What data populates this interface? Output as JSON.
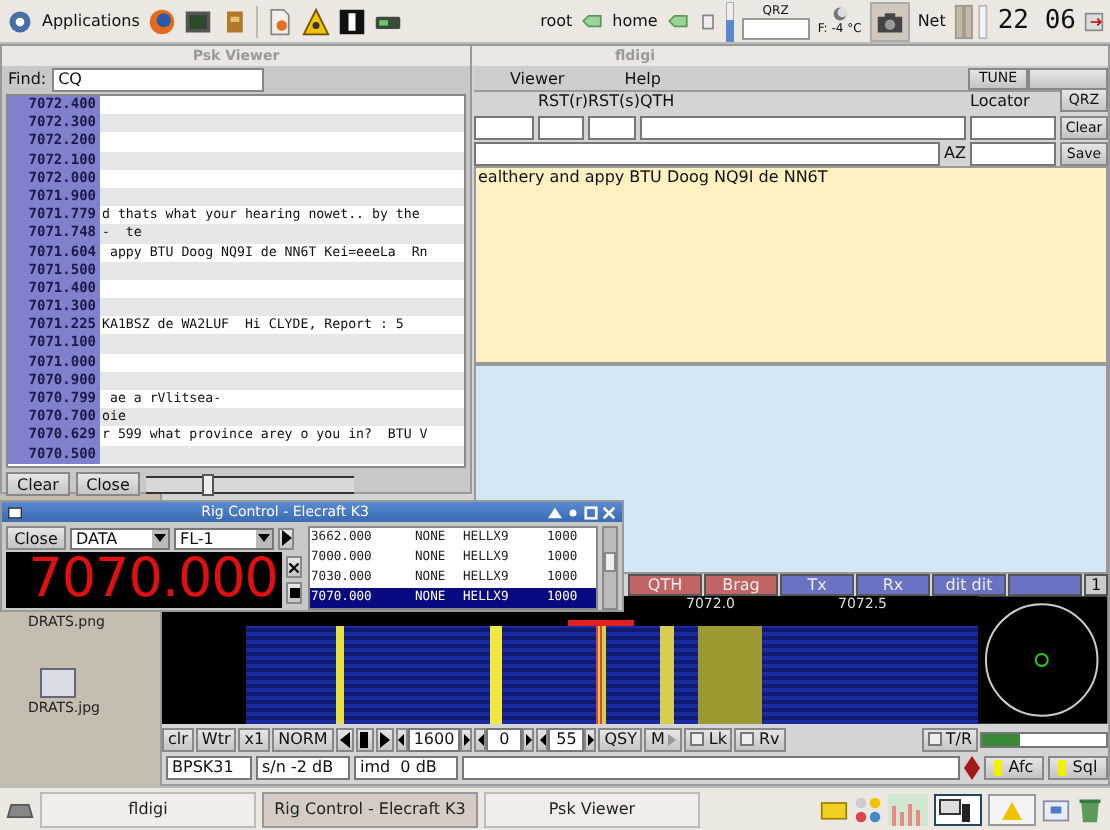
{
  "top_panel": {
    "menu": "Applications",
    "places": [
      "root",
      "home"
    ],
    "qrz_label": "QRZ",
    "temperature": "F: -4 °C",
    "network": "Net",
    "clock": "22 06"
  },
  "desktop_icons": [
    {
      "label": "DRATS.png"
    },
    {
      "label": "DRATS.jpg"
    }
  ],
  "fldigi": {
    "title": "fldigi",
    "menu": [
      "Viewer",
      "Help"
    ],
    "tune": "TUNE",
    "log_labels": [
      "RST(r)",
      "RST(s)",
      "QTH",
      "Locator"
    ],
    "az": "AZ",
    "log_buttons": [
      "QRZ",
      "Clear",
      "Save"
    ],
    "rx_text": "ealthery and appy BTU Doog NQ9I de NN6T",
    "macros": [
      {
        "label": "QTH",
        "color": "#c06464"
      },
      {
        "label": "Brag",
        "color": "#c06464"
      },
      {
        "label": "Tx",
        "color": "#6a72c4"
      },
      {
        "label": "Rx",
        "color": "#6a72c4"
      },
      {
        "label": "dit dit",
        "color": "#6a72c4"
      },
      {
        "color": "#6a72c4"
      }
    ],
    "macro_page": "1",
    "scale": [
      "7072.0",
      "7072.5"
    ],
    "controls": [
      {
        "kind": "button",
        "label": "clr"
      },
      {
        "kind": "button",
        "label": "Wtr"
      },
      {
        "kind": "button",
        "label": "x1"
      },
      {
        "kind": "button",
        "label": "NORM"
      },
      {
        "kind": "rewind"
      },
      {
        "kind": "pause"
      },
      {
        "kind": "play"
      },
      {
        "kind": "spin",
        "value": "1600"
      },
      {
        "kind": "spin",
        "value": "0"
      },
      {
        "kind": "spin",
        "value": "55"
      },
      {
        "kind": "button",
        "label": "QSY"
      },
      {
        "kind": "menu",
        "label": "M"
      },
      {
        "kind": "check",
        "label": "Lk",
        "checked": false
      },
      {
        "kind": "check",
        "label": "Rv",
        "checked": false
      }
    ],
    "tr": {
      "label": "T/R",
      "checked": false
    },
    "squelch": {
      "level": 0.3
    },
    "status": {
      "mode": "BPSK31",
      "snr": "s/n -2 dB",
      "imd": "imd  0 dB"
    },
    "toggles": [
      {
        "label": "Afc",
        "on": true
      },
      {
        "label": "Sql",
        "on": true
      }
    ]
  },
  "psk_viewer": {
    "title": "Psk Viewer",
    "find_label": "Find:",
    "find": "CQ",
    "rows": [
      {
        "freq": "7072.400"
      },
      {
        "freq": "7072.300"
      },
      {
        "freq": "7072.200"
      },
      {
        "freq": "7072.100"
      },
      {
        "freq": "7072.000"
      },
      {
        "freq": "7071.900"
      },
      {
        "freq": "7071.779",
        "text": "d thats what your hearing nowet.. by the"
      },
      {
        "freq": "7071.748",
        "text": "-  te"
      },
      {
        "freq": "7071.604",
        "text": " appy BTU Doog NQ9I de NN6T Kei=eeeLa  Rn"
      },
      {
        "freq": "7071.500"
      },
      {
        "freq": "7071.400"
      },
      {
        "freq": "7071.300"
      },
      {
        "freq": "7071.225",
        "text": "KA1BSZ de WA2LUF  Hi CLYDE, Report : 5"
      },
      {
        "freq": "7071.100"
      },
      {
        "freq": "7071.000"
      },
      {
        "freq": "7070.900"
      },
      {
        "freq": "7070.799",
        "text": " ae a rVlitsea-"
      },
      {
        "freq": "7070.700",
        "text": "oie"
      },
      {
        "freq": "7070.629",
        "text": "r 599 what province arey o you in?  BTU V"
      },
      {
        "freq": "7070.500"
      }
    ],
    "buttons": [
      "Clear",
      "Close"
    ],
    "slider": {
      "level": 0.3
    }
  },
  "rig_control": {
    "title": "Rig Control - Elecraft K3",
    "close": "Close",
    "mode": "DATA",
    "filter": "FL-1",
    "frequency": "7070.000",
    "memories": [
      {
        "freq": "3662.000",
        "mode": "NONE",
        "name": "HELLX9",
        "bw": "1000",
        "selected": false
      },
      {
        "freq": "7000.000",
        "mode": "NONE",
        "name": "HELLX9",
        "bw": "1000",
        "selected": false
      },
      {
        "freq": "7030.000",
        "mode": "NONE",
        "name": "HELLX9",
        "bw": "1000",
        "selected": false
      },
      {
        "freq": "7070.000",
        "mode": "NONE",
        "name": "HELLX9",
        "bw": "1000",
        "selected": true
      }
    ]
  },
  "taskbar": [
    {
      "label": "fldigi",
      "selected": false
    },
    {
      "label": "Rig Control - Elecraft K3",
      "selected": true
    },
    {
      "label": "Psk Viewer",
      "selected": false
    }
  ]
}
